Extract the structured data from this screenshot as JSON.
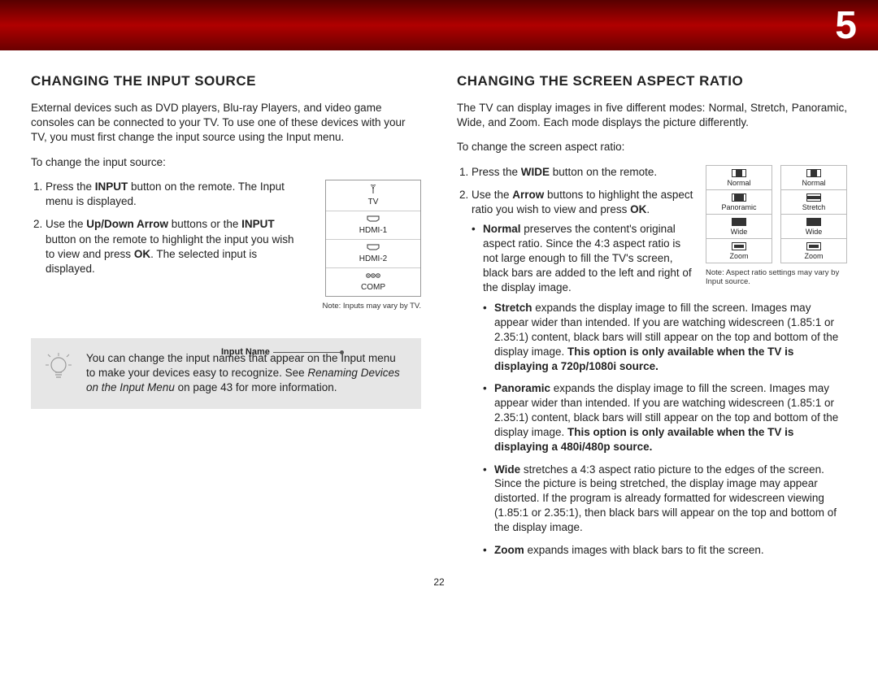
{
  "chapter_number": "5",
  "page_number": "22",
  "left": {
    "heading": "CHANGING THE INPUT SOURCE",
    "intro": "External devices such as DVD players, Blu-ray Players, and video game consoles can be connected to your TV. To use one of these devices with your TV, you must first change the input source using the Input menu.",
    "lead": "To change the input source:",
    "step1_a": "Press the ",
    "step1_b": "INPUT",
    "step1_c": " button on the remote. The Input menu is displayed.",
    "step2_a": "Use the ",
    "step2_b": "Up/Down Arrow",
    "step2_c": " buttons or the ",
    "step2_d": "INPUT",
    "step2_e": " button on the remote to highlight the input you wish to view and press ",
    "step2_f": "OK",
    "step2_g": ". The selected input is displayed.",
    "menu_items": [
      "TV",
      "HDMI-1",
      "HDMI-2",
      "COMP"
    ],
    "input_name_label": "Input Name",
    "note": "Note: Inputs may vary by TV.",
    "tip_a": "You can change the input names that appear on the Input menu to make your devices easy to recognize. See ",
    "tip_b": "Renaming Devices on the Input Menu",
    "tip_c": " on page 43 for more information."
  },
  "right": {
    "heading": "CHANGING THE SCREEN ASPECT RATIO",
    "intro": "The TV can display images in five different modes: Normal, Stretch, Panoramic, Wide, and Zoom. Each mode displays the picture differently.",
    "lead": "To change the screen aspect ratio:",
    "step1_a": "Press the ",
    "step1_b": "WIDE",
    "step1_c": " button on the remote.",
    "step2_a": "Use the ",
    "step2_b": "Arrow",
    "step2_c": " buttons to highlight the aspect ratio you wish to view and press ",
    "step2_d": "OK",
    "step2_e": ".",
    "normal_b": "Normal",
    "normal_t": " preserves the content's original aspect ratio. Since the 4:3 aspect ratio is not large enough to fill the TV's screen, black bars are added to the left and right of the display image.",
    "stretch_b": "Stretch",
    "stretch_t": " expands the display image to fill the screen. Images may appear wider than intended. If you are watching widescreen (1.85:1 or 2.35:1) content, black bars will still appear on the top and bottom of the display image. ",
    "stretch_bold": "This option is only available when the TV is displaying a 720p/1080i source.",
    "pano_b": "Panoramic",
    "pano_t": " expands the display image to fill the screen. Images may appear wider than intended. If you are watching widescreen (1.85:1 or 2.35:1) content, black bars will still appear on the top and bottom of the display image. ",
    "pano_bold": "This option is only available when the TV is displaying a 480i/480p source.",
    "wide_b": "Wide",
    "wide_t": " stretches a 4:3 aspect ratio picture to the edges of the screen. Since the picture is being stretched, the display image may appear distorted. If the program is already formatted for widescreen viewing (1.85:1 or 2.35:1), then black bars will appear on the top and bottom of the display image.",
    "zoom_b": "Zoom",
    "zoom_t": " expands images with black bars to fit the screen.",
    "aspect_col1": [
      "Normal",
      "Panoramic",
      "Wide",
      "Zoom"
    ],
    "aspect_col2": [
      "Normal",
      "Stretch",
      "Wide",
      "Zoom"
    ],
    "aspect_note": "Note: Aspect ratio settings may vary by Input source."
  }
}
